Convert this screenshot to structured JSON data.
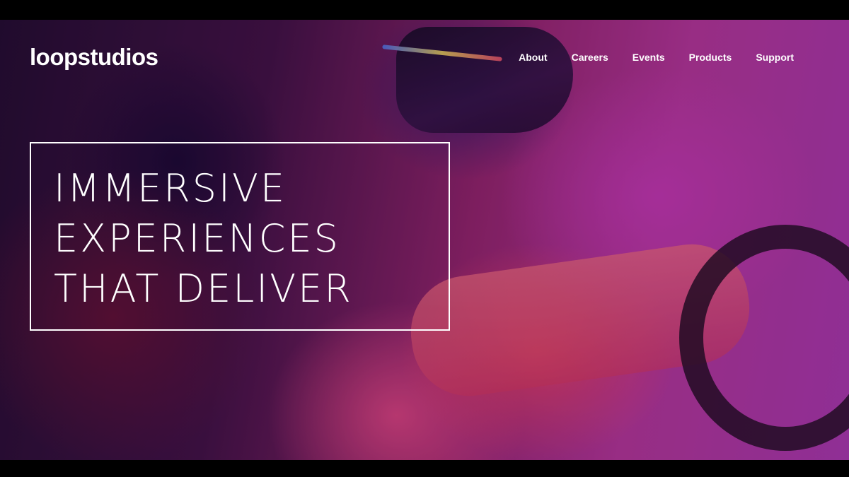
{
  "logo": {
    "text": "loopstudios"
  },
  "nav": {
    "items": [
      {
        "label": "About"
      },
      {
        "label": "Careers"
      },
      {
        "label": "Events"
      },
      {
        "label": "Products"
      },
      {
        "label": "Support"
      }
    ]
  },
  "hero": {
    "headline_lines": [
      "IMMERSIVE",
      "EXPERIENCES",
      "THAT DELIVER"
    ]
  }
}
